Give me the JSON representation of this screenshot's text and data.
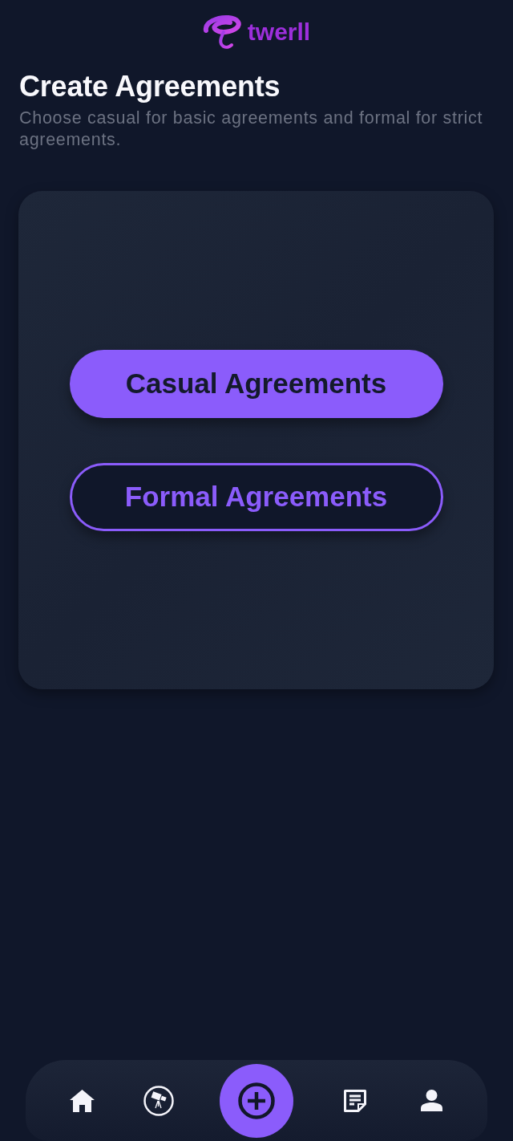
{
  "logo": {
    "text": "twerll"
  },
  "header": {
    "title": "Create Agreements",
    "subtitle": "Choose casual for basic agreements and formal for strict agreements."
  },
  "options": [
    {
      "label": "Casual Agreements",
      "kind": "filled"
    },
    {
      "label": "Formal Agreements",
      "kind": "outline"
    }
  ]
}
